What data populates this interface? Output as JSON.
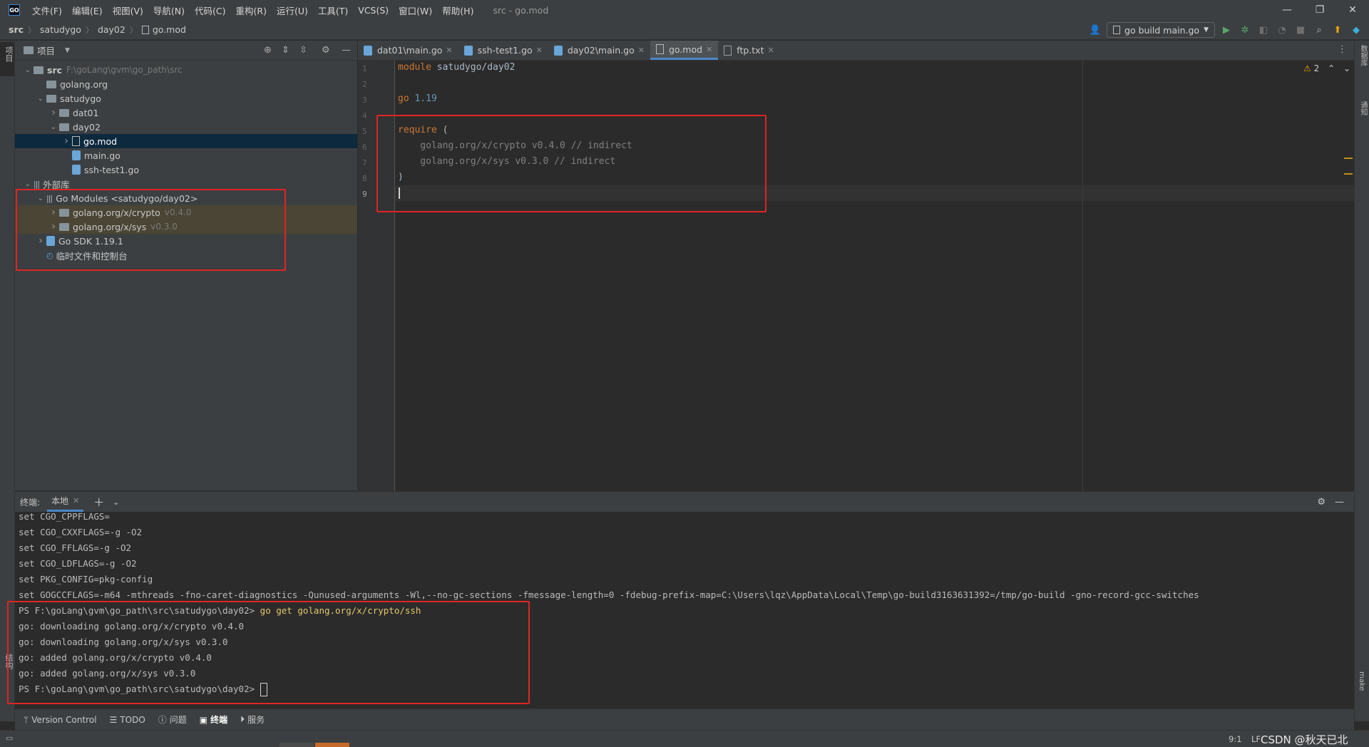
{
  "titlebar": {
    "logo": "GO",
    "menus": [
      "文件(F)",
      "编辑(E)",
      "视图(V)",
      "导航(N)",
      "代码(C)",
      "重构(R)",
      "运行(U)",
      "工具(T)",
      "VCS(S)",
      "窗口(W)",
      "帮助(H)"
    ],
    "window_title": "src - go.mod",
    "controls": [
      "—",
      "❐",
      "✕"
    ]
  },
  "navbar": {
    "breadcrumbs": [
      "src",
      "satudygo",
      "day02",
      "go.mod"
    ],
    "run_config": "go build main.go"
  },
  "left_stripe": {
    "project_label": "项目",
    "bottom_label": "结构"
  },
  "right_stripe": {
    "labels": [
      "数据库",
      "通知",
      "make"
    ]
  },
  "project_panel": {
    "title": "项目",
    "tree": [
      {
        "label": "src",
        "extra": "F:\\goLang\\gvm\\go_path\\src",
        "indent": 0,
        "arrow": "down",
        "icon": "folder",
        "bold": true
      },
      {
        "label": "golang.org",
        "indent": 1,
        "arrow": "",
        "icon": "folder"
      },
      {
        "label": "satudygo",
        "indent": 1,
        "arrow": "down",
        "icon": "folder"
      },
      {
        "label": "dat01",
        "indent": 2,
        "arrow": "right",
        "icon": "folder"
      },
      {
        "label": "day02",
        "indent": 2,
        "arrow": "down",
        "icon": "folder"
      },
      {
        "label": "go.mod",
        "indent": 3,
        "arrow": "right",
        "icon": "mod",
        "selected": true
      },
      {
        "label": "main.go",
        "indent": 3,
        "arrow": "",
        "icon": "go"
      },
      {
        "label": "ssh-test1.go",
        "indent": 3,
        "arrow": "",
        "icon": "go"
      },
      {
        "label": "外部库",
        "indent": 0,
        "arrow": "down",
        "icon": "lib"
      },
      {
        "label": "Go Modules <satudygo/day02>",
        "indent": 1,
        "arrow": "down",
        "icon": "lib"
      },
      {
        "label": "golang.org/x/crypto",
        "extra": "v0.4.0",
        "indent": 2,
        "arrow": "right",
        "icon": "folder",
        "highlight": true
      },
      {
        "label": "golang.org/x/sys",
        "extra": "v0.3.0",
        "indent": 2,
        "arrow": "right",
        "icon": "folder",
        "highlight": true
      },
      {
        "label": "Go SDK 1.19.1",
        "indent": 1,
        "arrow": "right",
        "icon": "go"
      },
      {
        "label": "临时文件和控制台",
        "indent": 1,
        "arrow": "",
        "icon": "scratch"
      }
    ]
  },
  "editor": {
    "tabs": [
      {
        "label": "dat01\\main.go",
        "icon": "go"
      },
      {
        "label": "ssh-test1.go",
        "icon": "go"
      },
      {
        "label": "day02\\main.go",
        "icon": "go"
      },
      {
        "label": "go.mod",
        "icon": "mod",
        "active": true
      },
      {
        "label": "ftp.txt",
        "icon": "txt"
      }
    ],
    "warning_count": "2",
    "line_numbers": [
      "1",
      "2",
      "3",
      "4",
      "5",
      "6",
      "7",
      "8",
      "9"
    ],
    "lines": {
      "l1_kw": "module",
      "l1_rest": " satudygo/day02",
      "l3_kw": "go",
      "l3_num": " 1.19",
      "l5_kw": "require",
      "l5_rest": " (",
      "l6": "    golang.org/x/crypto v0.4.0 // indirect",
      "l7": "    golang.org/x/sys v0.3.0 // indirect",
      "l8": ")"
    }
  },
  "terminal": {
    "title": "终端:",
    "tab": "本地",
    "lines": [
      "set CGO_CPPFLAGS=",
      "set CGO_CXXFLAGS=-g -O2",
      "set CGO_FFLAGS=-g -O2",
      "set CGO_LDFLAGS=-g -O2",
      "set PKG_CONFIG=pkg-config",
      "set GOGCCFLAGS=-m64 -mthreads -fno-caret-diagnostics -Qunused-arguments -Wl,--no-gc-sections -fmessage-length=0 -fdebug-prefix-map=C:\\Users\\lqz\\AppData\\Local\\Temp\\go-build3163631392=/tmp/go-build -gno-record-gcc-switches"
    ],
    "prompt": "PS F:\\goLang\\gvm\\go_path\\src\\satudygo\\day02>",
    "command": "go get golang.org/x/crypto/ssh",
    "output": [
      "go: downloading golang.org/x/crypto v0.4.0",
      "go: downloading golang.org/x/sys v0.3.0",
      "go: added golang.org/x/crypto v0.4.0",
      "go: added golang.org/x/sys v0.3.0"
    ],
    "final_prompt": "PS F:\\goLang\\gvm\\go_path\\src\\satudygo\\day02>"
  },
  "tool_stripe": [
    "Version Control",
    "TODO",
    "问题",
    "终端",
    "服务"
  ],
  "statusbar": {
    "position": "9:1",
    "line_sep": "LF",
    "watermark": "CSDN @秋天已北"
  },
  "colors": {
    "keyword": "#cc7832",
    "number": "#6897bb",
    "comment": "#808080",
    "annotation_red": "#e02424",
    "accent_blue": "#4a88c7"
  }
}
